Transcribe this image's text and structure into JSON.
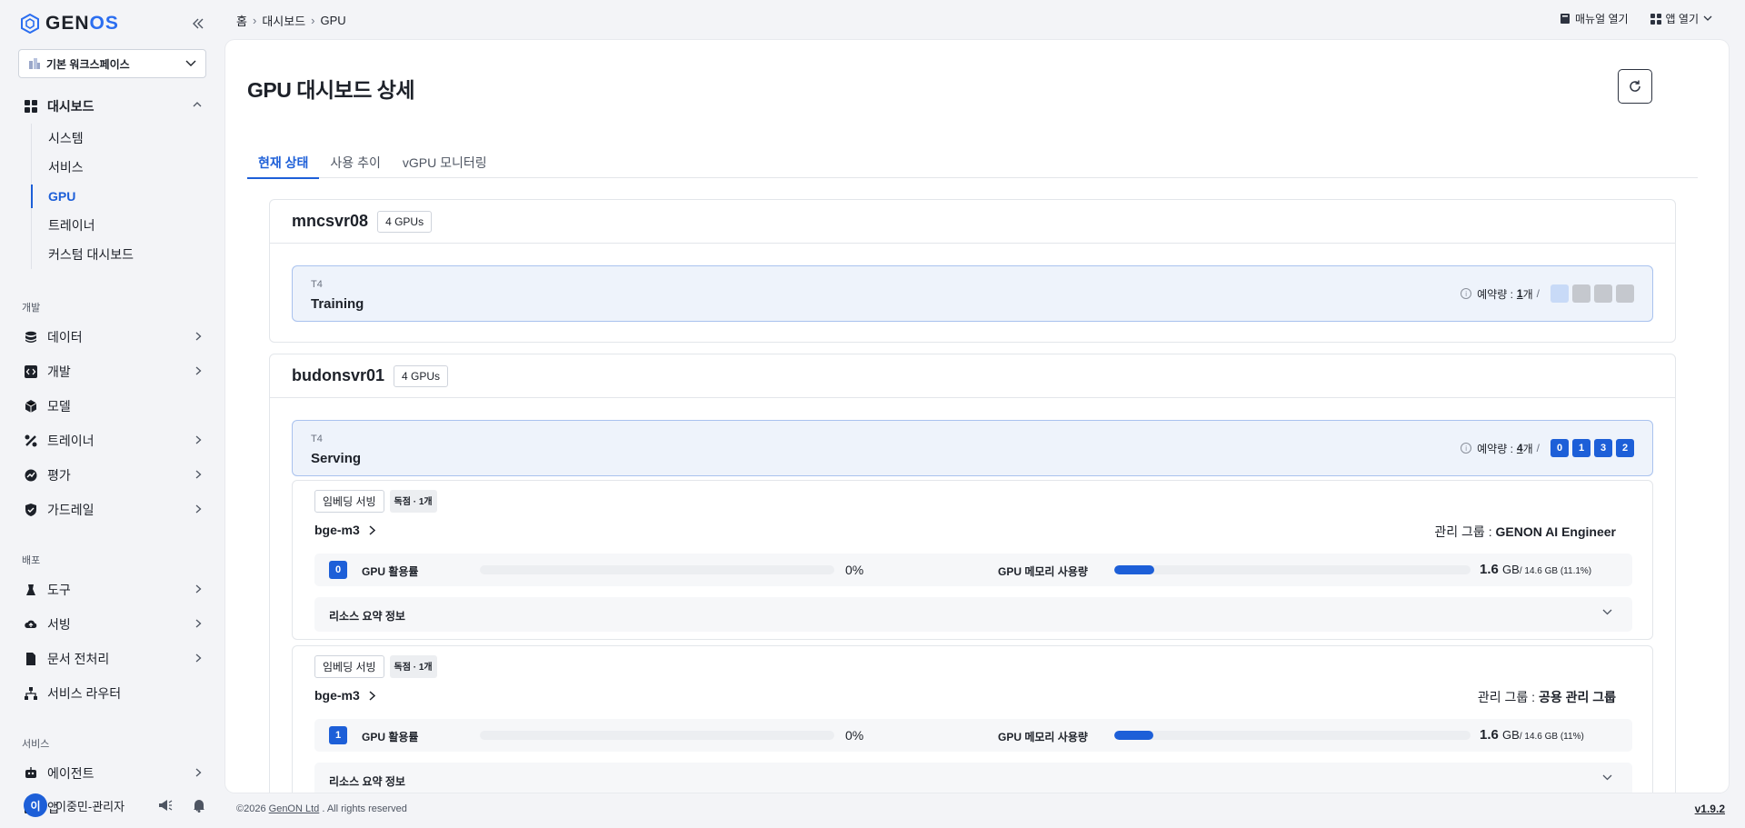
{
  "app": {
    "logo_text_a": "GEN",
    "logo_text_b": "OS"
  },
  "workspace": {
    "label": "기본 워크스페이스"
  },
  "sidebar": {
    "dashboard": {
      "label": "대시보드",
      "items": [
        "시스템",
        "서비스",
        "GPU",
        "트레이너",
        "커스텀 대시보드"
      ],
      "active": "GPU"
    },
    "sections": [
      {
        "label": "개발",
        "items": [
          {
            "label": "데이터",
            "arrow": true
          },
          {
            "label": "개발",
            "arrow": true
          },
          {
            "label": "모델",
            "arrow": false
          },
          {
            "label": "트레이너",
            "arrow": true
          },
          {
            "label": "평가",
            "arrow": true
          },
          {
            "label": "가드레일",
            "arrow": true
          }
        ]
      },
      {
        "label": "배포",
        "items": [
          {
            "label": "도구",
            "arrow": true
          },
          {
            "label": "서빙",
            "arrow": true
          },
          {
            "label": "문서 전처리",
            "arrow": true
          },
          {
            "label": "서비스 라우터",
            "arrow": false
          }
        ]
      },
      {
        "label": "서비스",
        "items": [
          {
            "label": "에이전트",
            "arrow": true
          },
          {
            "label": "앱",
            "arrow": true
          }
        ]
      }
    ],
    "user": {
      "avatar": "이",
      "name": "이중민-관리자"
    }
  },
  "topbar": {
    "breadcrumb": [
      "홈",
      "대시보드",
      "GPU"
    ],
    "manual": "매뉴얼 열기",
    "open_app": "앱 열기"
  },
  "page": {
    "title": "GPU 대시보드 상세",
    "tabs": [
      "현재 상태",
      "사용 추이",
      "vGPU 모니터링"
    ],
    "active_tab": "현재 상태"
  },
  "servers": [
    {
      "name": "mncsvr08",
      "gpu_count": "4 GPUs",
      "group": {
        "model": "T4",
        "name": "Training",
        "reserve_label": "예약량 :",
        "reserve_num": "1",
        "reserve_unit": "개",
        "slash": "/",
        "slots": [
          {
            "t": "",
            "c": "light"
          },
          {
            "t": "",
            "c": "gray"
          },
          {
            "t": "",
            "c": "gray"
          },
          {
            "t": "",
            "c": "gray"
          }
        ]
      }
    },
    {
      "name": "budonsvr01",
      "gpu_count": "4 GPUs",
      "group": {
        "model": "T4",
        "name": "Serving",
        "reserve_label": "예약량 :",
        "reserve_num": "4",
        "reserve_unit": "개",
        "slash": "/",
        "slots": [
          {
            "t": "0",
            "c": "blue"
          },
          {
            "t": "1",
            "c": "blue"
          },
          {
            "t": "3",
            "c": "blue"
          },
          {
            "t": "2",
            "c": "blue"
          }
        ]
      },
      "services": [
        {
          "type": "임베딩 서빙",
          "mode": "독점 · 1개",
          "name": "bge-m3",
          "group_label": "관리 그룹 :",
          "group": "GENON AI Engineer",
          "gpu_index": "0",
          "util_label": "GPU 활용률",
          "util": "0%",
          "util_fraction": 0,
          "mem_label": "GPU 메모리 사용량",
          "mem_used": "1.6",
          "mem_unit": "GB",
          "mem_total": "/ 14.6 GB (11.1%)",
          "mem_fraction": 0.111,
          "summary": "리소스 요약 정보"
        },
        {
          "type": "임베딩 서빙",
          "mode": "독점 · 1개",
          "name": "bge-m3",
          "group_label": "관리 그룹 :",
          "group": "공용 관리 그룹",
          "gpu_index": "1",
          "util_label": "GPU 활용률",
          "util": "0%",
          "util_fraction": 0,
          "mem_label": "GPU 메모리 사용량",
          "mem_used": "1.6",
          "mem_unit": "GB",
          "mem_total": "/ 14.6 GB (11%)",
          "mem_fraction": 0.11,
          "summary": "리소스 요약 정보"
        }
      ]
    }
  ],
  "footer": {
    "copyright_a": "©2026 ",
    "company": "GenON Ltd",
    "copyright_b": " . All rights reserved",
    "version": "v1.9.2"
  },
  "colors": {
    "accent": "#1d5fd8",
    "group_bg": "#eef3fb",
    "group_border": "#a9c2ee"
  }
}
